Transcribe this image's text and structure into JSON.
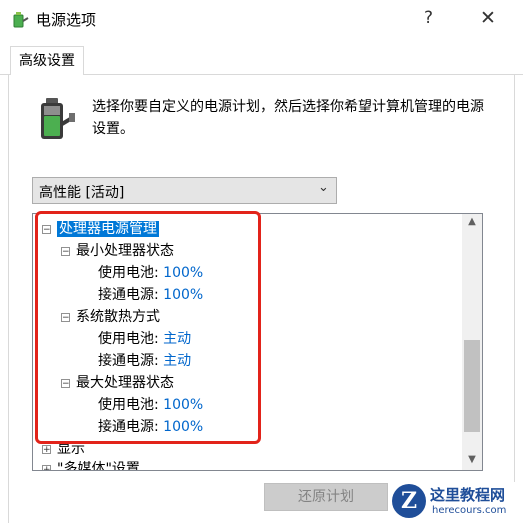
{
  "window": {
    "title": "电源选项",
    "help_glyph": "?",
    "close_glyph": "✕"
  },
  "tabs": [
    {
      "label": "高级设置"
    }
  ],
  "description": "选择你要自定义的电源计划，然后选择你希望计算机管理的电源设置。",
  "plan_select": {
    "value": "高性能 [活动]"
  },
  "tree": {
    "processor": {
      "label": "处理器电源管理",
      "min_state": {
        "label": "最小处理器状态",
        "battery_label": "使用电池:",
        "battery_value": "100%",
        "plugged_label": "接通电源:",
        "plugged_value": "100%"
      },
      "cooling": {
        "label": "系统散热方式",
        "battery_label": "使用电池:",
        "battery_value": "主动",
        "plugged_label": "接通电源:",
        "plugged_value": "主动"
      },
      "max_state": {
        "label": "最大处理器状态",
        "battery_label": "使用电池:",
        "battery_value": "100%",
        "plugged_label": "接通电源:",
        "plugged_value": "100%"
      }
    },
    "display": {
      "label": "显示"
    },
    "multimedia": {
      "label": "\"多媒体\"设置"
    }
  },
  "buttons": {
    "restore": "还原计划"
  },
  "watermark": {
    "title": "这里教程网",
    "url": "herecours.com"
  },
  "colors": {
    "accent": "#0078d7",
    "value": "#0066cc",
    "highlight_box": "#e2231a"
  },
  "icons": {
    "app": "battery-plug-icon"
  }
}
